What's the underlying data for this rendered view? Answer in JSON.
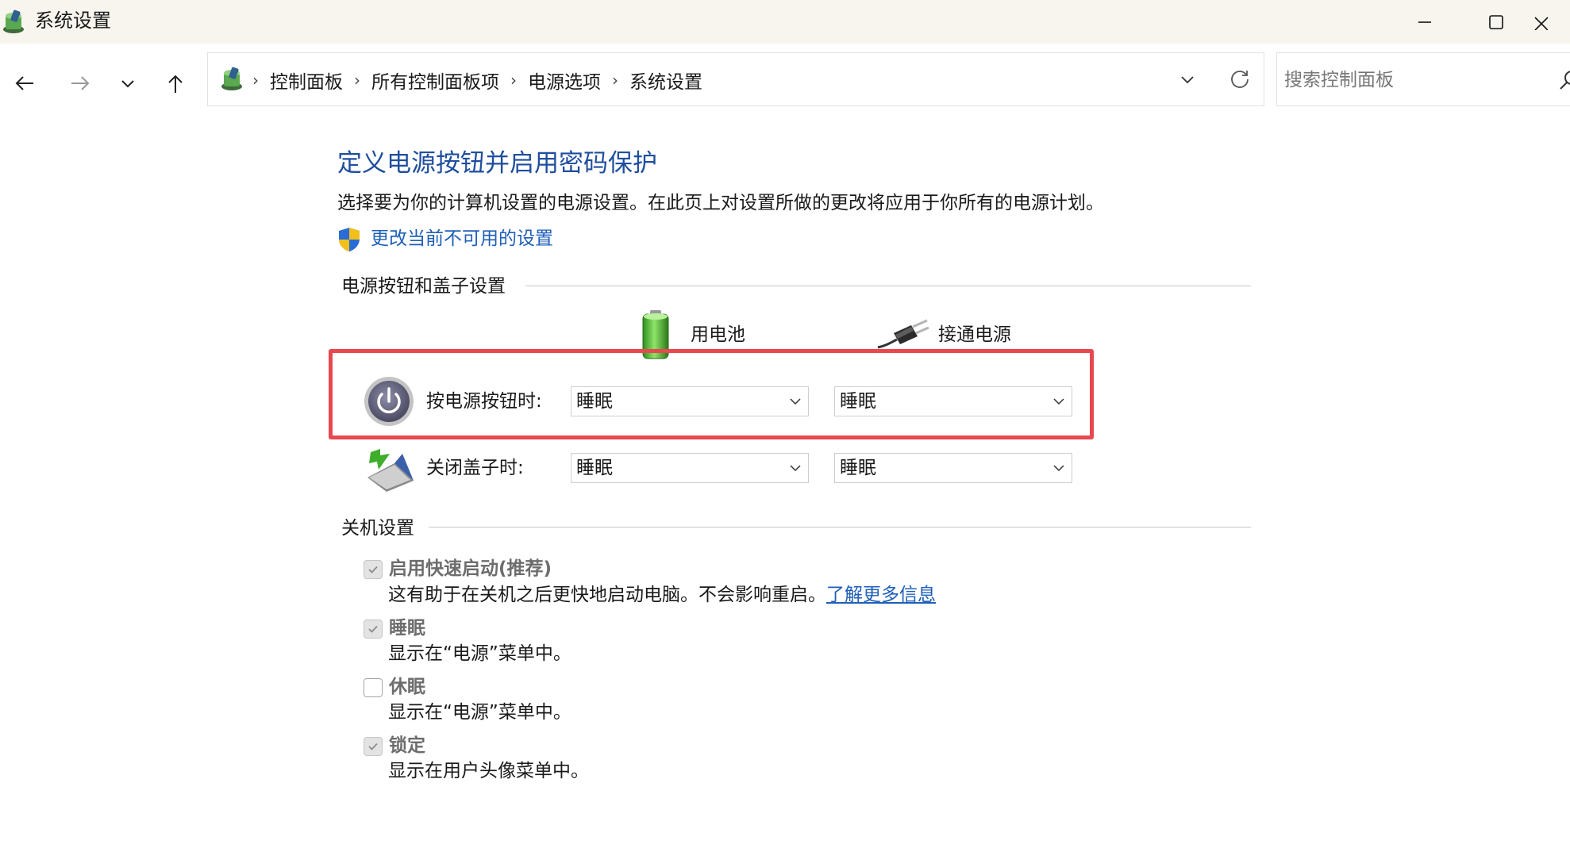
{
  "window": {
    "title": "系统设置",
    "icon": "control-panel-icon"
  },
  "nav": {
    "breadcrumb": [
      "控制面板",
      "所有控制面板项",
      "电源选项",
      "系统设置"
    ],
    "separator": "›",
    "search": {
      "value": "",
      "placeholder": "搜索控制面板"
    }
  },
  "main": {
    "title": "定义电源按钮并启用密码保护",
    "description": "选择要为你的计算机设置的电源设置。在此页上对设置所做的更改将应用于你所有的电源计划。",
    "change_settings_link": "更改当前不可用的设置"
  },
  "power_buttons_section": {
    "title": "电源按钮和盖子设置",
    "columns": {
      "battery": "用电池",
      "plugged_in": "接通电源"
    },
    "rows": [
      {
        "label": "按电源按钮时:",
        "battery": "睡眠",
        "plugged_in": "睡眠",
        "highlighted": true
      },
      {
        "label": "关闭盖子时:",
        "battery": "睡眠",
        "plugged_in": "睡眠",
        "highlighted": false
      }
    ]
  },
  "shutdown_section": {
    "title": "关机设置",
    "options": [
      {
        "label": "启用快速启动(推荐)",
        "description": "这有助于在关机之后更快地启动电脑。不会影响重启。",
        "link": "了解更多信息",
        "checked": true,
        "disabled": true
      },
      {
        "label": "睡眠",
        "description": "显示在“电源”菜单中。",
        "checked": true,
        "disabled": true
      },
      {
        "label": "休眠",
        "description": "显示在“电源”菜单中。",
        "checked": false,
        "disabled": true
      },
      {
        "label": "锁定",
        "description": "显示在用户头像菜单中。",
        "checked": true,
        "disabled": true
      }
    ]
  },
  "colors": {
    "title_blue": "#1f4e9e",
    "link_blue": "#1f5fb8",
    "highlight_red": "#e8484f",
    "titlebar_bg": "#f8f5ee"
  }
}
